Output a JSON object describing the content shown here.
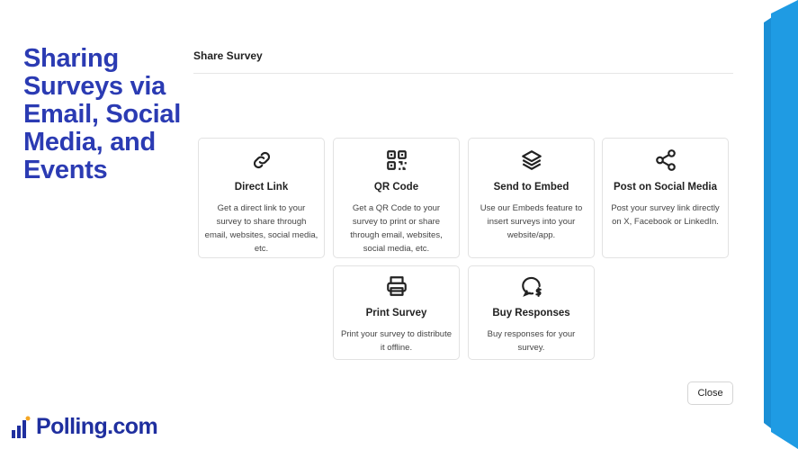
{
  "headline": "Sharing Surveys via Email, Social Media, and Events",
  "brand": {
    "name": "Polling.com",
    "color": "#1f2f9f"
  },
  "dialog": {
    "title": "Share Survey",
    "close_label": "Close",
    "options": [
      {
        "icon": "link-icon",
        "title": "Direct Link",
        "description": "Get a direct link to your survey to share through email, websites, social media, etc."
      },
      {
        "icon": "qr-code-icon",
        "title": "QR Code",
        "description": "Get a QR Code to your survey to print or share through email, websites, social media, etc."
      },
      {
        "icon": "layers-icon",
        "title": "Send to Embed",
        "description": "Use our Embeds feature to insert surveys into your website/app."
      },
      {
        "icon": "share-icon",
        "title": "Post on Social Media",
        "description": "Post your survey link directly on X, Facebook or LinkedIn."
      },
      {
        "icon": "printer-icon",
        "title": "Print Survey",
        "description": "Print your survey to distribute it offline."
      },
      {
        "icon": "chat-dollar-icon",
        "title": "Buy Responses",
        "description": "Buy responses for your survey."
      }
    ]
  },
  "colors": {
    "headline": "#2b3bb3",
    "accent_band": "#1a8fd6"
  }
}
